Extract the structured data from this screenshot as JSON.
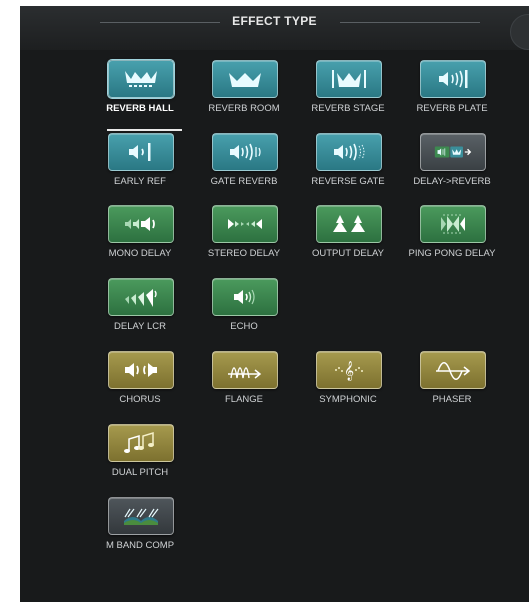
{
  "header": {
    "title": "EFFECT TYPE"
  },
  "effects": [
    {
      "label": "REVERB HALL",
      "icon": "reverb-hall-icon",
      "group": "reverb",
      "selected": true
    },
    {
      "label": "REVERB ROOM",
      "icon": "reverb-room-icon",
      "group": "reverb"
    },
    {
      "label": "REVERB STAGE",
      "icon": "reverb-stage-icon",
      "group": "reverb"
    },
    {
      "label": "REVERB PLATE",
      "icon": "reverb-plate-icon",
      "group": "reverb"
    },
    {
      "label": "EARLY REF",
      "icon": "early-ref-icon",
      "group": "reverb"
    },
    {
      "label": "GATE REVERB",
      "icon": "gate-reverb-icon",
      "group": "reverb"
    },
    {
      "label": "REVERSE GATE",
      "icon": "reverse-gate-icon",
      "group": "reverb"
    },
    {
      "label": "DELAY->REVERB",
      "icon": "delay-reverb-icon",
      "group": "combo"
    },
    {
      "label": "MONO DELAY",
      "icon": "mono-delay-icon",
      "group": "delay"
    },
    {
      "label": "STEREO DELAY",
      "icon": "stereo-delay-icon",
      "group": "delay"
    },
    {
      "label": "OUTPUT DELAY",
      "icon": "output-delay-icon",
      "group": "delay"
    },
    {
      "label": "PING PONG DELAY",
      "icon": "ping-pong-delay-icon",
      "group": "delay"
    },
    {
      "label": "DELAY LCR",
      "icon": "delay-lcr-icon",
      "group": "delay"
    },
    {
      "label": "ECHO",
      "icon": "echo-icon",
      "group": "delay"
    },
    {
      "label": "CHORUS",
      "icon": "chorus-icon",
      "group": "modulation"
    },
    {
      "label": "FLANGE",
      "icon": "flange-icon",
      "group": "modulation"
    },
    {
      "label": "SYMPHONIC",
      "icon": "symphonic-icon",
      "group": "modulation"
    },
    {
      "label": "PHASER",
      "icon": "phaser-icon",
      "group": "modulation"
    },
    {
      "label": "DUAL PITCH",
      "icon": "dual-pitch-icon",
      "group": "modulation"
    },
    {
      "label": "M BAND COMP",
      "icon": "m-band-comp-icon",
      "group": "dynamics"
    }
  ],
  "colors": {
    "reverb": "#3a8e9a",
    "delay": "#3d8a50",
    "modulation": "#978a40",
    "dynamics": "#42484c",
    "combo": "#42484c"
  }
}
